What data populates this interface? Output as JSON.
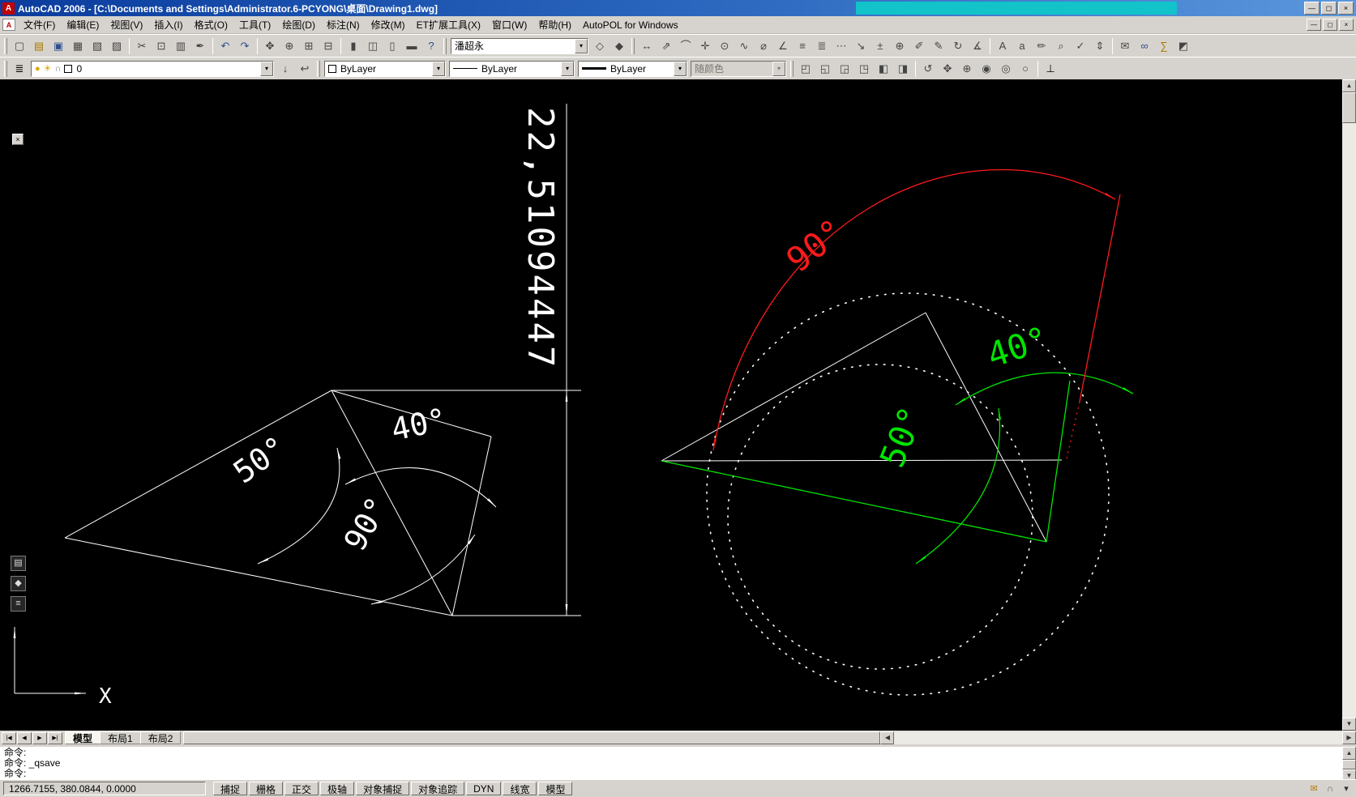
{
  "window": {
    "title": "AutoCAD 2006 - [C:\\Documents and Settings\\Administrator.6-PCYONG\\桌面\\Drawing1.dwg]",
    "app_icon_glyph": "A",
    "minimize_glyph": "—",
    "maximize_glyph": "◻",
    "close_glyph": "×"
  },
  "overlay": {
    "color": "#12c3c9"
  },
  "mdi": {
    "doc_icon_glyph": "A",
    "minimize_glyph": "—",
    "restore_glyph": "◻",
    "close_glyph": "×"
  },
  "ui": {
    "dropdown_glyph": "▾",
    "scroll_up": "▲",
    "scroll_down": "▼",
    "scroll_left": "◀",
    "scroll_right": "▶"
  },
  "menu": {
    "items": [
      {
        "id": "menu-file",
        "label": "文件(F)"
      },
      {
        "id": "menu-edit",
        "label": "编辑(E)"
      },
      {
        "id": "menu-view",
        "label": "视图(V)"
      },
      {
        "id": "menu-insert",
        "label": "插入(I)"
      },
      {
        "id": "menu-format",
        "label": "格式(O)"
      },
      {
        "id": "menu-tools",
        "label": "工具(T)"
      },
      {
        "id": "menu-draw",
        "label": "绘图(D)"
      },
      {
        "id": "menu-dimension",
        "label": "标注(N)"
      },
      {
        "id": "menu-modify",
        "label": "修改(M)"
      },
      {
        "id": "menu-express",
        "label": "ET扩展工具(X)"
      },
      {
        "id": "menu-window",
        "label": "窗口(W)"
      },
      {
        "id": "menu-help",
        "label": "帮助(H)"
      },
      {
        "id": "menu-autopol",
        "label": "AutoPOL for Windows"
      }
    ]
  },
  "toolbar1": {
    "file_icons": [
      {
        "name": "qnew-icon",
        "glyph": "▢",
        "color": "#444444"
      },
      {
        "name": "open-icon",
        "glyph": "▤",
        "color": "#a87b00"
      },
      {
        "name": "save-icon",
        "glyph": "▣",
        "color": "#2f4f8f"
      },
      {
        "name": "plot-icon",
        "glyph": "▦",
        "color": "#444444"
      },
      {
        "name": "plot-preview-icon",
        "glyph": "▧",
        "color": "#444444"
      },
      {
        "name": "publish-icon",
        "glyph": "▨",
        "color": "#444444"
      }
    ],
    "clipboard_icons": [
      {
        "name": "cut-icon",
        "glyph": "✂",
        "color": "#444444"
      },
      {
        "name": "copy-icon",
        "glyph": "⊡",
        "color": "#444444"
      },
      {
        "name": "paste-icon",
        "glyph": "▥",
        "color": "#444444"
      },
      {
        "name": "match-properties-icon",
        "glyph": "✒",
        "color": "#444444"
      }
    ],
    "undo_icons": [
      {
        "name": "undo-icon",
        "glyph": "↶",
        "color": "#2f4f8f"
      },
      {
        "name": "redo-icon",
        "glyph": "↷",
        "color": "#2f4f8f"
      }
    ],
    "zoom_icons": [
      {
        "name": "pan-icon",
        "glyph": "✥",
        "color": "#444444"
      },
      {
        "name": "zoom-realtime-icon",
        "glyph": "⊕",
        "color": "#444444"
      },
      {
        "name": "zoom-window-icon",
        "glyph": "⊞",
        "color": "#444444"
      },
      {
        "name": "zoom-previous-icon",
        "glyph": "⊟",
        "color": "#444444"
      }
    ],
    "palette_icons": [
      {
        "name": "properties-icon",
        "glyph": "▮",
        "color": "#444444"
      },
      {
        "name": "designcenter-icon",
        "glyph": "◫",
        "color": "#444444"
      },
      {
        "name": "tool-palettes-icon",
        "glyph": "▯",
        "color": "#444444"
      },
      {
        "name": "sheetset-manager-icon",
        "glyph": "▬",
        "color": "#444444"
      },
      {
        "name": "help-icon",
        "glyph": "?",
        "color": "#2f4f8f"
      }
    ],
    "style_combo_value": "潘超永",
    "block_icons": [
      {
        "name": "insert-block-icon",
        "glyph": "◇",
        "color": "#444444"
      },
      {
        "name": "make-block-icon",
        "glyph": "◆",
        "color": "#444444"
      }
    ],
    "dim_icons": [
      {
        "name": "dim-linear-icon",
        "glyph": "↔",
        "color": "#444444"
      },
      {
        "name": "dim-aligned-icon",
        "glyph": "⇗",
        "color": "#444444"
      },
      {
        "name": "dim-arc-length-icon",
        "glyph": "⌒",
        "color": "#444444"
      },
      {
        "name": "dim-ordinate-icon",
        "glyph": "✛",
        "color": "#444444"
      },
      {
        "name": "dim-radius-icon",
        "glyph": "⊙",
        "color": "#444444"
      },
      {
        "name": "dim-jogged-icon",
        "glyph": "∿",
        "color": "#444444"
      },
      {
        "name": "dim-diameter-icon",
        "glyph": "⌀",
        "color": "#444444"
      },
      {
        "name": "dim-angular-icon",
        "glyph": "∠",
        "color": "#444444"
      },
      {
        "name": "quick-dimension-icon",
        "glyph": "≡",
        "color": "#444444"
      },
      {
        "name": "dim-baseline-icon",
        "glyph": "≣",
        "color": "#444444"
      },
      {
        "name": "dim-continue-icon",
        "glyph": "⋯",
        "color": "#444444"
      },
      {
        "name": "quick-leader-icon",
        "glyph": "↘",
        "color": "#444444"
      },
      {
        "name": "tolerance-icon",
        "glyph": "±",
        "color": "#444444"
      },
      {
        "name": "center-mark-icon",
        "glyph": "⊕",
        "color": "#444444"
      },
      {
        "name": "dimension-edit-icon",
        "glyph": "✐",
        "color": "#444444"
      },
      {
        "name": "dimension-text-edit-icon",
        "glyph": "✎",
        "color": "#444444"
      },
      {
        "name": "dimension-update-icon",
        "glyph": "↻",
        "color": "#444444"
      },
      {
        "name": "dimension-style-icon",
        "glyph": "∡",
        "color": "#444444"
      }
    ],
    "text_icons": [
      {
        "name": "mtext-icon",
        "glyph": "A",
        "color": "#444444"
      },
      {
        "name": "single-line-text-icon",
        "glyph": "a",
        "color": "#444444"
      },
      {
        "name": "edit-text-icon",
        "glyph": "✏",
        "color": "#444444"
      },
      {
        "name": "find-replace-icon",
        "glyph": "⌕",
        "color": "#444444"
      },
      {
        "name": "spell-check-icon",
        "glyph": "✓",
        "color": "#444444"
      },
      {
        "name": "scale-text-icon",
        "glyph": "⇕",
        "color": "#444444"
      }
    ],
    "misc_icons": [
      {
        "name": "etransmit-icon",
        "glyph": "✉",
        "color": "#444444"
      },
      {
        "name": "hyperlink-icon",
        "glyph": "∞",
        "color": "#2f4f8f"
      },
      {
        "name": "quickcalc-icon",
        "glyph": "∑",
        "color": "#a87b00"
      },
      {
        "name": "render-icon",
        "glyph": "◩",
        "color": "#444444"
      }
    ]
  },
  "toolbar2": {
    "layers_icon": {
      "name": "layer-properties-manager-icon",
      "glyph": "≣",
      "color": "#444444"
    },
    "layer_combo": {
      "value": "0",
      "bulb_glyph": "●",
      "sun_glyph": "☀",
      "lock_glyph": "∩"
    },
    "layer_icons": [
      {
        "name": "make-object-layer-current-icon",
        "glyph": "↓",
        "color": "#444444"
      },
      {
        "name": "layer-previous-icon",
        "glyph": "↩",
        "color": "#444444"
      }
    ],
    "color_combo_value": "ByLayer",
    "linetype_combo_value": "ByLayer",
    "lineweight_combo_value": "ByLayer",
    "plotstyle_combo_value": "随颜色",
    "view_icons": [
      {
        "name": "view-top-icon",
        "glyph": "◰",
        "color": "#444444"
      },
      {
        "name": "view-bottom-icon",
        "glyph": "◱",
        "color": "#444444"
      },
      {
        "name": "view-left-icon",
        "glyph": "◲",
        "color": "#444444"
      },
      {
        "name": "view-right-icon",
        "glyph": "◳",
        "color": "#444444"
      },
      {
        "name": "view-front-icon",
        "glyph": "◧",
        "color": "#444444"
      },
      {
        "name": "view-back-icon",
        "glyph": "◨",
        "color": "#444444"
      }
    ],
    "orbit_icons": [
      {
        "name": "orbit-icon",
        "glyph": "↺",
        "color": "#444444"
      },
      {
        "name": "pan-3d-icon",
        "glyph": "✥",
        "color": "#444444"
      },
      {
        "name": "zoom-3d-icon",
        "glyph": "⊕",
        "color": "#444444"
      },
      {
        "name": "shade-icon",
        "glyph": "◉",
        "color": "#444444"
      },
      {
        "name": "hide-icon",
        "glyph": "◎",
        "color": "#444444"
      },
      {
        "name": "wireframe-icon",
        "glyph": "○",
        "color": "#444444"
      }
    ],
    "ucs_icon": {
      "name": "ucs-toolbar-icon",
      "glyph": "⊥",
      "color": "#444444"
    }
  },
  "float_toolbar": {
    "close_glyph": "×",
    "icons": [
      {
        "name": "float-tool-icon-1",
        "glyph": "▤"
      },
      {
        "name": "float-tool-icon-2",
        "glyph": "◆"
      },
      {
        "name": "float-tool-icon-3",
        "glyph": "≡"
      }
    ]
  },
  "canvas": {
    "labels": {
      "dim_value": "22,51094447",
      "left_angle_50": "50°",
      "left_angle_40": "40°",
      "left_angle_90": "90°",
      "right_angle_90": "90°",
      "right_angle_40": "40°",
      "right_angle_50": "50°",
      "ucs_x": "X"
    },
    "colors": {
      "background": "#000000",
      "line": "#ffffff",
      "red": "#ff1a1a",
      "green": "#00e400"
    }
  },
  "tabs": {
    "nav": [
      {
        "id": "tab-scroll-first",
        "glyph": "|◀"
      },
      {
        "id": "tab-scroll-prev",
        "glyph": "◀"
      },
      {
        "id": "tab-scroll-next",
        "glyph": "▶"
      },
      {
        "id": "tab-scroll-last",
        "glyph": "▶|"
      }
    ],
    "items": [
      {
        "id": "tab-model",
        "label": "模型",
        "active": true
      },
      {
        "id": "tab-layout1",
        "label": "布局1",
        "active": false
      },
      {
        "id": "tab-layout2",
        "label": "布局2",
        "active": false
      }
    ]
  },
  "command": {
    "lines": [
      "命令:",
      "命令: _qsave",
      "命令:"
    ]
  },
  "statusbar": {
    "coords": "1266.7155, 380.0844, 0.0000",
    "toggles": [
      {
        "id": "status-snap",
        "label": "捕捉",
        "pressed": false
      },
      {
        "id": "status-grid",
        "label": "栅格",
        "pressed": false
      },
      {
        "id": "status-ortho",
        "label": "正交",
        "pressed": false
      },
      {
        "id": "status-polar",
        "label": "极轴",
        "pressed": false
      },
      {
        "id": "status-osnap",
        "label": "对象捕捉",
        "pressed": false
      },
      {
        "id": "status-otrack",
        "label": "对象追踪",
        "pressed": false
      },
      {
        "id": "status-dyn",
        "label": "DYN",
        "pressed": false
      },
      {
        "id": "status-lwt",
        "label": "线宽",
        "pressed": false
      },
      {
        "id": "status-model",
        "label": "模型",
        "pressed": false
      }
    ],
    "right_icons": [
      {
        "name": "communication-center-icon",
        "glyph": "✉",
        "color": "#b07800"
      },
      {
        "name": "toolbar-lock-icon",
        "glyph": "∩",
        "color": "#555555"
      },
      {
        "name": "status-menu-arrow-icon",
        "glyph": "▾",
        "color": "#333333"
      }
    ]
  }
}
